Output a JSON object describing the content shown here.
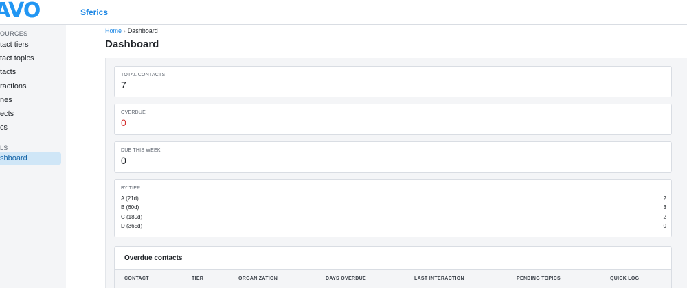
{
  "header": {
    "logo_text": "AVO",
    "app_name": "Sferics"
  },
  "sidebar": {
    "resources_heading": "OURCES",
    "resource_items": [
      "tact tiers",
      "tact topics",
      "tacts",
      "ractions",
      "nes",
      "ects",
      "cs"
    ],
    "tools_heading": "LS",
    "tools_items": [
      "shboard"
    ],
    "active_item": "shboard"
  },
  "breadcrumb": {
    "home": "Home",
    "separator": "›",
    "current": "Dashboard"
  },
  "page": {
    "title": "Dashboard"
  },
  "cards": {
    "total_contacts": {
      "label": "TOTAL CONTACTS",
      "value": "7"
    },
    "overdue": {
      "label": "OVERDUE",
      "value": "0",
      "value_color": "#d32f2f"
    },
    "due_this_week": {
      "label": "DUE THIS WEEK",
      "value": "0"
    }
  },
  "by_tier": {
    "label": "BY TIER",
    "rows": [
      {
        "name": "A (21d)",
        "count": "2"
      },
      {
        "name": "B (60d)",
        "count": "3"
      },
      {
        "name": "C (180d)",
        "count": "2"
      },
      {
        "name": "D (365d)",
        "count": "0"
      }
    ]
  },
  "overdue_contacts": {
    "title": "Overdue contacts",
    "columns": [
      "CONTACT",
      "TIER",
      "ORGANIZATION",
      "DAYS OVERDUE",
      "LAST INTERACTION",
      "PENDING TOPICS",
      "QUICK LOG"
    ]
  },
  "colors": {
    "brand": "#2196f3",
    "link": "#1e88e5",
    "danger": "#d32f2f",
    "active_bg": "#cfe6f7"
  }
}
